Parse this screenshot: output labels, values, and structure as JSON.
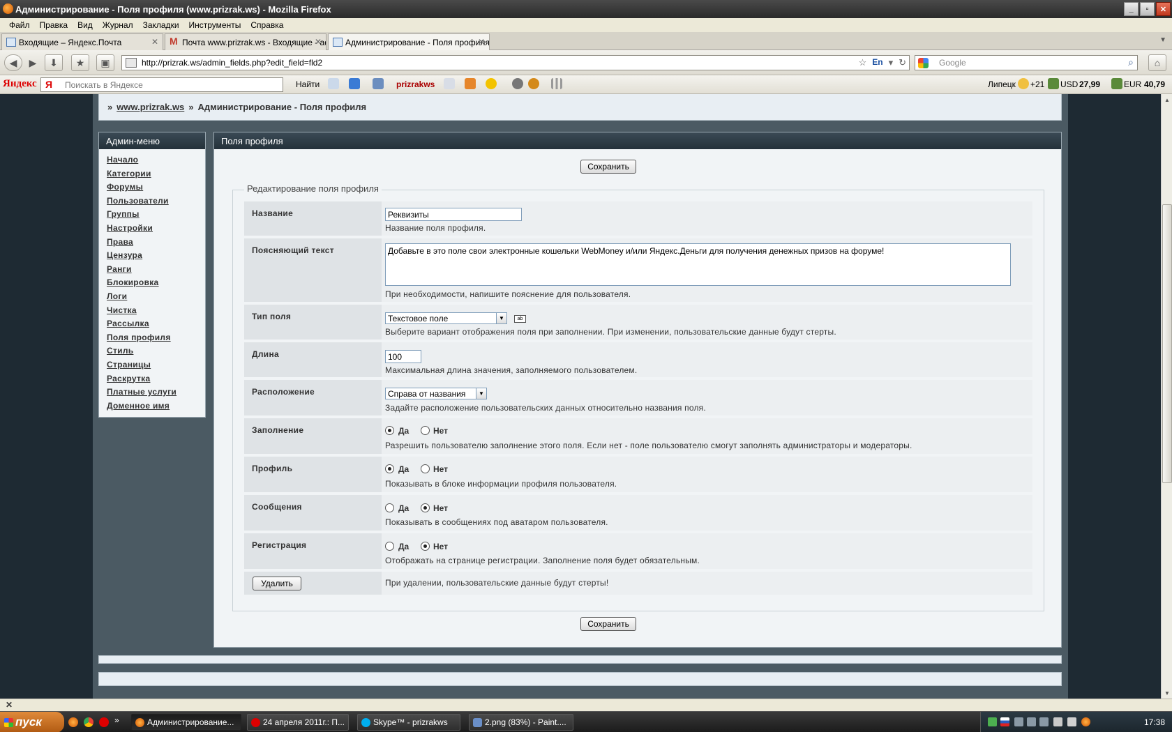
{
  "window": {
    "title": "Администрирование - Поля профиля (www.prizrak.ws) - Mozilla Firefox"
  },
  "menu": [
    "Файл",
    "Правка",
    "Вид",
    "Журнал",
    "Закладки",
    "Инструменты",
    "Справка"
  ],
  "tabs": [
    {
      "label": "Входящие – Яндекс.Почта"
    },
    {
      "label": "Почта www.prizrak.ws - Входящие - admi..."
    },
    {
      "label": "Администрирование - Поля профиля (w..."
    }
  ],
  "nav": {
    "url": "http://prizrak.ws/admin_fields.php?edit_field=fld2",
    "lang": "En",
    "search_placeholder": "Google"
  },
  "ytoolbar": {
    "logo": "Яндекс",
    "search_placeholder": "Поискать в Яндексе",
    "find": "Найти",
    "user": "prizrakws",
    "city": "Липецк",
    "temp": "+21",
    "usd_label": "USD",
    "usd": "27,99",
    "eur_label": "EUR",
    "eur": "40,79"
  },
  "breadcrumb": {
    "prefix": "»",
    "site": "www.prizrak.ws",
    "sep": "»",
    "current": "Администрирование - Поля профиля"
  },
  "sidebar": {
    "title": "Админ-меню",
    "items": [
      "Начало",
      "Категории",
      "Форумы",
      "Пользователи",
      "Группы",
      "Настройки",
      "Права",
      "Цензура",
      "Ранги",
      "Блокировка",
      "Логи",
      "Чистка",
      "Рассылка",
      "Поля профиля",
      "Стиль",
      "Страницы",
      "Раскрутка",
      "Платные услуги",
      "Доменное имя"
    ]
  },
  "main": {
    "title": "Поля профиля",
    "save": "Сохранить",
    "legend": "Редактирование поля профиля",
    "name_label": "Название",
    "name_value": "Реквизиты",
    "name_hint": "Название поля профиля.",
    "desc_label": "Поясняющий текст",
    "desc_value": "Добавьте в это поле свои электронные кошельки WebMoney и/или Яндекс.Деньги для получения денежных призов на форуме!",
    "desc_hint": "При необходимости, напишите пояснение для пользователя.",
    "type_label": "Тип поля",
    "type_value": "Текстовое поле",
    "type_hint": "Выберите вариант отображения поля при заполнении. При изменении, пользовательские данные будут стерты.",
    "len_label": "Длина",
    "len_value": "100",
    "len_hint": "Максимальная длина значения, заполняемого пользователем.",
    "pos_label": "Расположение",
    "pos_value": "Справа от названия",
    "pos_hint": "Задайте расположение пользовательских данных относительно названия поля.",
    "yes": "Да",
    "no": "Нет",
    "fill_label": "Заполнение",
    "fill_hint": "Разрешить пользователю заполнение этого поля. Если нет - поле пользователю смогут заполнять администраторы и модераторы.",
    "profile_label": "Профиль",
    "profile_hint": "Показывать в блоке информации профиля пользователя.",
    "msg_label": "Сообщения",
    "msg_hint": "Показывать в сообщениях под аватаром пользователя.",
    "reg_label": "Регистрация",
    "reg_hint": "Отображать на странице регистрации. Заполнение поля будет обязательным.",
    "delete": "Удалить",
    "delete_hint": "При удалении, пользовательские данные будут стерты!"
  },
  "taskbar": {
    "start": "пуск",
    "items": [
      "Администрирование...",
      "24 апреля 2011г.: П...",
      "Skype™ - prizrakws",
      "2.png (83%) - Paint...."
    ],
    "clock": "17:38"
  }
}
